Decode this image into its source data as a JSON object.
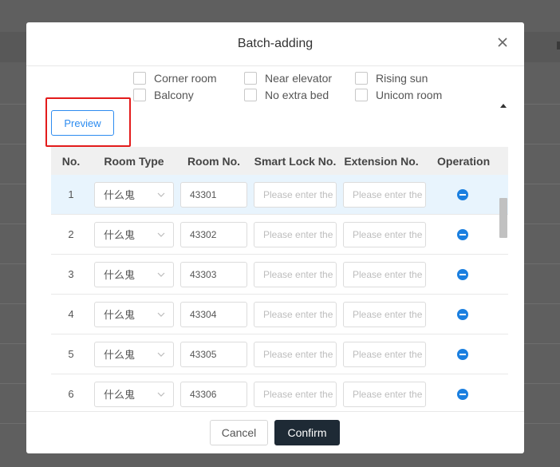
{
  "dialog": {
    "title": "Batch-adding",
    "close_icon": "close-icon"
  },
  "features": {
    "row1": [
      "Corner room",
      "Near elevator",
      "Rising sun"
    ],
    "row2": [
      "Balcony",
      "No extra bed",
      "Unicom room"
    ]
  },
  "preview_label": "Preview",
  "table": {
    "headers": {
      "no": "No.",
      "room_type": "Room Type",
      "room_no": "Room No.",
      "lock": "Smart Lock No.",
      "ext": "Extension No.",
      "op": "Operation"
    },
    "placeholder": "Please enter the",
    "rows": [
      {
        "no": "1",
        "type": "什么鬼",
        "room": "43301"
      },
      {
        "no": "2",
        "type": "什么鬼",
        "room": "43302"
      },
      {
        "no": "3",
        "type": "什么鬼",
        "room": "43303"
      },
      {
        "no": "4",
        "type": "什么鬼",
        "room": "43304"
      },
      {
        "no": "5",
        "type": "什么鬼",
        "room": "43305"
      },
      {
        "no": "6",
        "type": "什么鬼",
        "room": "43306"
      }
    ]
  },
  "footer": {
    "cancel_label": "Cancel",
    "confirm_label": "Confirm"
  }
}
